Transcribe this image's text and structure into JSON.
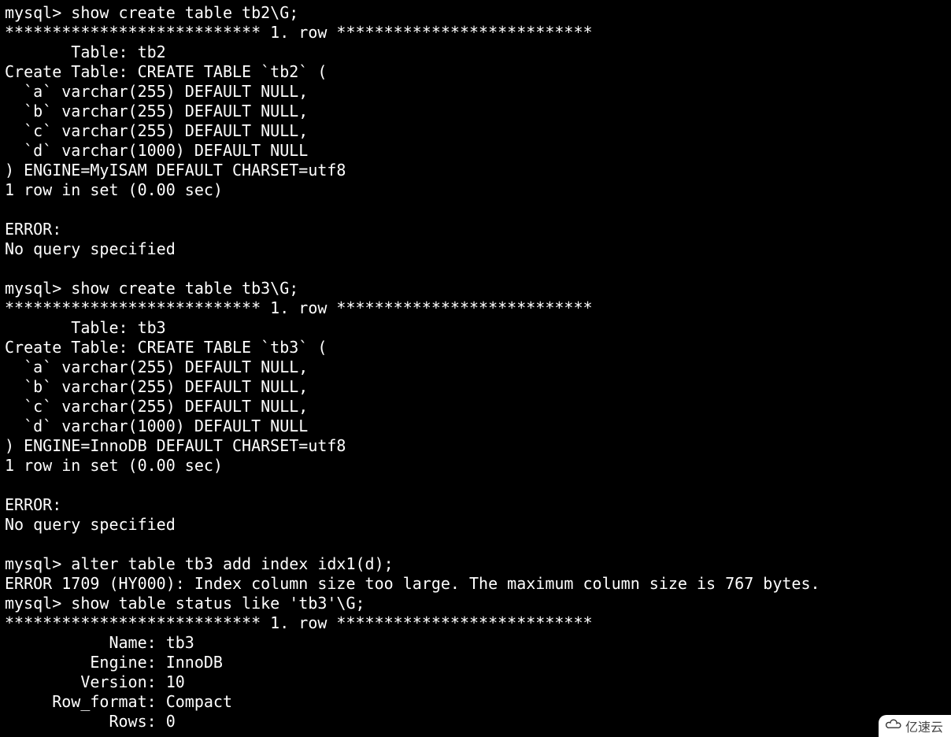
{
  "lines": {
    "l01": "mysql> show create table tb2\\G;",
    "l02": "*************************** 1. row ***************************",
    "l03": "       Table: tb2",
    "l04": "Create Table: CREATE TABLE `tb2` (",
    "l05": "  `a` varchar(255) DEFAULT NULL,",
    "l06": "  `b` varchar(255) DEFAULT NULL,",
    "l07": "  `c` varchar(255) DEFAULT NULL,",
    "l08": "  `d` varchar(1000) DEFAULT NULL",
    "l09": ") ENGINE=MyISAM DEFAULT CHARSET=utf8",
    "l10": "1 row in set (0.00 sec)",
    "l11": "",
    "l12": "ERROR:",
    "l13": "No query specified",
    "l14": "",
    "l15": "mysql> show create table tb3\\G;",
    "l16": "*************************** 1. row ***************************",
    "l17": "       Table: tb3",
    "l18": "Create Table: CREATE TABLE `tb3` (",
    "l19": "  `a` varchar(255) DEFAULT NULL,",
    "l20": "  `b` varchar(255) DEFAULT NULL,",
    "l21": "  `c` varchar(255) DEFAULT NULL,",
    "l22": "  `d` varchar(1000) DEFAULT NULL",
    "l23": ") ENGINE=InnoDB DEFAULT CHARSET=utf8",
    "l24": "1 row in set (0.00 sec)",
    "l25": "",
    "l26": "ERROR:",
    "l27": "No query specified",
    "l28": "",
    "l29": "mysql> alter table tb3 add index idx1(d);",
    "l30": "ERROR 1709 (HY000): Index column size too large. The maximum column size is 767 bytes.",
    "l31": "mysql> show table status like 'tb3'\\G;",
    "l32": "*************************** 1. row ***************************",
    "l33": "           Name: tb3",
    "l34": "         Engine: InnoDB",
    "l35": "        Version: 10",
    "l36": "     Row_format: Compact",
    "l37": "           Rows: 0"
  },
  "watermark": {
    "text": "亿速云"
  }
}
